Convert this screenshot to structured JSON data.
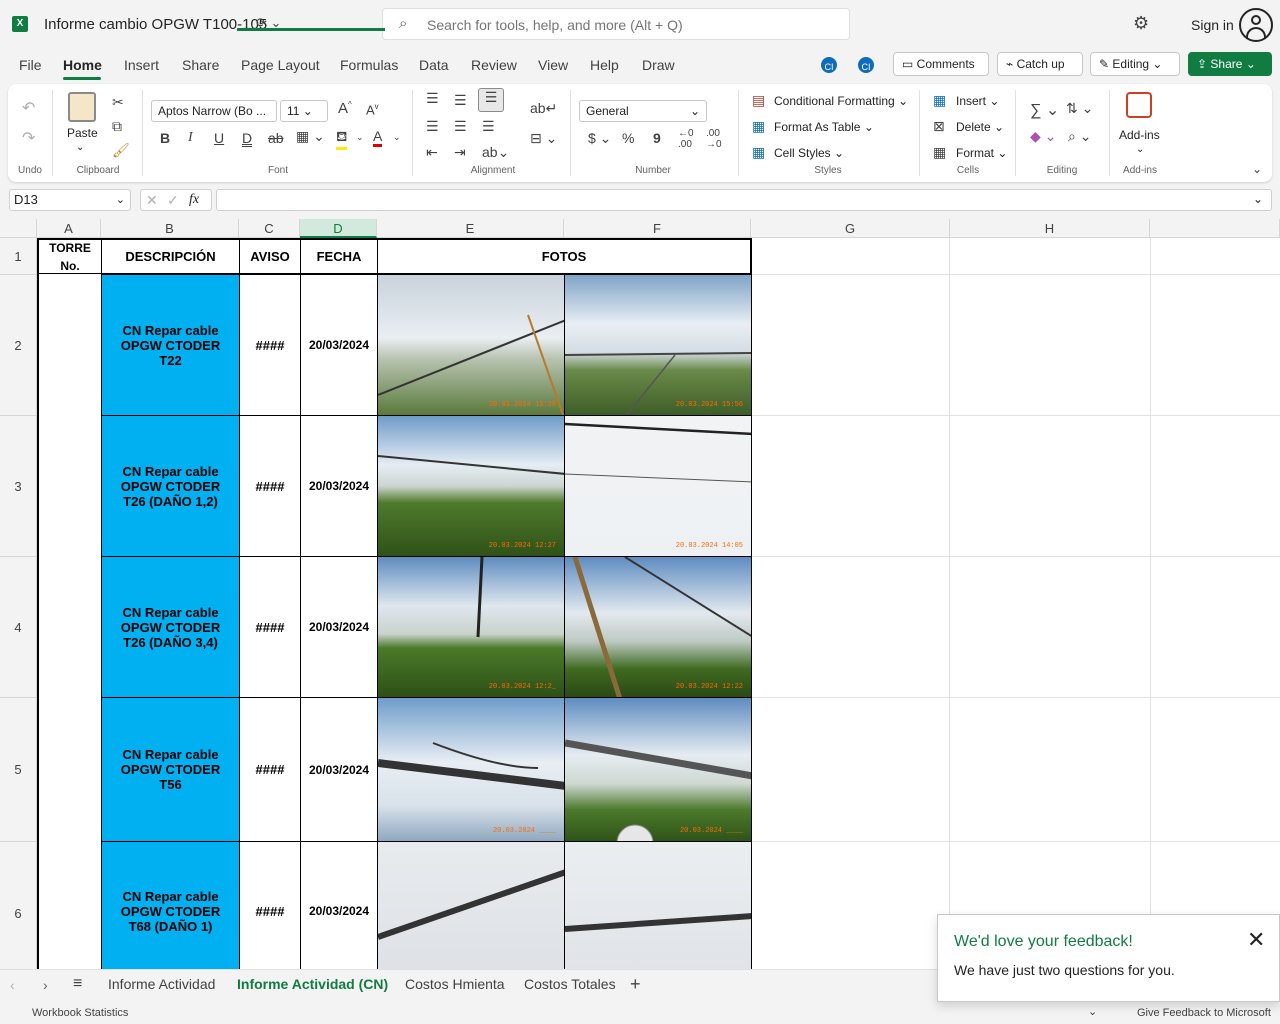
{
  "app": {
    "doc_title": "Informe cambio OPGW T100-105",
    "search_placeholder": "Search for tools, help, and more (Alt + Q)",
    "sign_in": "Sign in",
    "logo_letter": "X"
  },
  "menu": {
    "tabs": [
      "File",
      "Home",
      "Insert",
      "Share",
      "Page Layout",
      "Formulas",
      "Data",
      "Review",
      "View",
      "Help",
      "Draw"
    ],
    "active": "Home",
    "presence": [
      "CI",
      "CI"
    ],
    "comments": "Comments",
    "catch_up": "Catch up",
    "editing": "Editing",
    "share": "Share"
  },
  "ribbon": {
    "undo": "Undo",
    "paste": "Paste",
    "clipboard": "Clipboard",
    "font_name": "Aptos Narrow (Bo ...",
    "font_size": "11",
    "font": "Font",
    "alignment": "Alignment",
    "number_format": "General",
    "number": "Number",
    "conditional_formatting": "Conditional Formatting",
    "format_as_table": "Format As Table",
    "cell_styles": "Cell Styles",
    "styles": "Styles",
    "insert": "Insert",
    "delete": "Delete",
    "format": "Format",
    "cells": "Cells",
    "editing": "Editing",
    "add_ins": "Add-ins",
    "add_ins_group": "Add-ins",
    "currency_symbol": "$",
    "percent_symbol": "%",
    "comma_symbol": "9"
  },
  "formula_bar": {
    "name_box": "D13",
    "fx": "fx",
    "value": ""
  },
  "grid": {
    "columns": [
      "A",
      "B",
      "C",
      "D",
      "E",
      "F",
      "G",
      "H"
    ],
    "selected_column": "D",
    "rows": [
      "1",
      "2",
      "3",
      "4",
      "5",
      "6"
    ],
    "headers": {
      "torre": "TORRE No.",
      "descripcion": "DESCRIPCIÓN",
      "aviso": "AVISO",
      "fecha": "FECHA",
      "fotos": "FOTOS"
    },
    "data_rows": [
      {
        "descripcion": "CN Repar cable OPGW CTODER T22",
        "aviso": "####",
        "fecha": "20/03/2024",
        "stamp_e": "20.03.2024 15:28",
        "stamp_f": "20.03.2024 15:56"
      },
      {
        "descripcion": "CN Repar cable OPGW CTODER T26 (DAÑO 1,2)",
        "aviso": "####",
        "fecha": "20/03/2024",
        "stamp_e": "20.03.2024 12:27",
        "stamp_f": "20.03.2024 14:05"
      },
      {
        "descripcion": "CN Repar cable OPGW CTODER T26 (DAÑO 3,4)",
        "aviso": "####",
        "fecha": "20/03/2024",
        "stamp_e": "20.03.2024 12:2_",
        "stamp_f": "20.03.2024 12:22"
      },
      {
        "descripcion": "CN Repar cable OPGW CTODER T56",
        "aviso": "####",
        "fecha": "20/03/2024",
        "stamp_e": "20.03.2024 ____",
        "stamp_f": "20.03.2024 ____"
      },
      {
        "descripcion": "CN Repar cable OPGW CTODER T68 (DAÑO 1)",
        "aviso": "####",
        "fecha": "20/03/2024",
        "stamp_e": "",
        "stamp_f": ""
      }
    ]
  },
  "sheets": {
    "tabs": [
      "Informe Actividad",
      "Informe Actividad (CN)",
      "Costos Hmienta",
      "Costos Totales"
    ],
    "active": "Informe Actividad (CN)"
  },
  "status": {
    "workbook_statistics": "Workbook Statistics",
    "give_feedback": "Give Feedback to Microsoft"
  },
  "feedback": {
    "title": "We'd love your feedback!",
    "body": "We have just two questions for you."
  },
  "colors": {
    "accent": "#107c41",
    "cell_blue": "#00b0f0",
    "presence": "#0f6cbd"
  }
}
